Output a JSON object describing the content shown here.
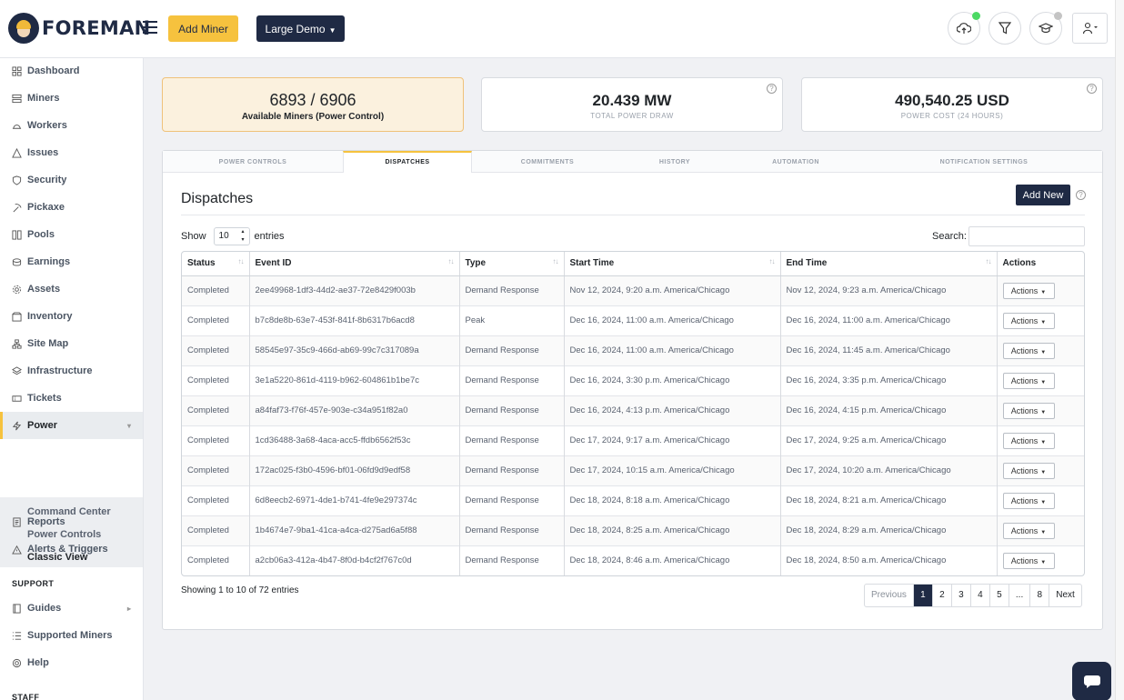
{
  "header": {
    "brand": "FOREMAN",
    "add_miner": "Add Miner",
    "demo": "Large Demo",
    "status_dot_colors": {
      "upload": "#4cd964",
      "learn": "#c4c4c4"
    }
  },
  "sidebar": {
    "items": [
      {
        "label": "Dashboard",
        "icon": "dashboard-icon"
      },
      {
        "label": "Miners",
        "icon": "server-icon"
      },
      {
        "label": "Workers",
        "icon": "hardhat-icon"
      },
      {
        "label": "Issues",
        "icon": "warning-icon"
      },
      {
        "label": "Security",
        "icon": "shield-icon"
      },
      {
        "label": "Pickaxe",
        "icon": "pickaxe-icon"
      },
      {
        "label": "Pools",
        "icon": "pools-icon"
      },
      {
        "label": "Earnings",
        "icon": "coins-icon"
      },
      {
        "label": "Assets",
        "icon": "gear-icon"
      },
      {
        "label": "Inventory",
        "icon": "box-icon"
      },
      {
        "label": "Site Map",
        "icon": "sitemap-icon"
      },
      {
        "label": "Infrastructure",
        "icon": "layers-icon"
      },
      {
        "label": "Tickets",
        "icon": "ticket-icon"
      },
      {
        "label": "Power",
        "icon": "bolt-icon"
      }
    ],
    "power_sub": [
      "Command Center",
      "Power Controls",
      "Classic View"
    ],
    "after_items": [
      {
        "label": "Reports",
        "icon": "report-icon"
      },
      {
        "label": "Alerts & Triggers",
        "icon": "alert-icon"
      }
    ],
    "support_label": "SUPPORT",
    "support_items": [
      {
        "label": "Guides",
        "icon": "book-icon"
      },
      {
        "label": "Supported Miners",
        "icon": "list-icon"
      },
      {
        "label": "Help",
        "icon": "lifebuoy-icon"
      }
    ],
    "staff_label": "STAFF"
  },
  "stats": [
    {
      "value": "6893 / 6906",
      "label": "Available Miners (Power Control)"
    },
    {
      "value": "20.439 MW",
      "label": "TOTAL POWER DRAW"
    },
    {
      "value": "490,540.25 USD",
      "label": "POWER COST (24 HOURS)"
    }
  ],
  "tabs": [
    "POWER CONTROLS",
    "DISPATCHES",
    "COMMITMENTS",
    "HISTORY",
    "AUTOMATION",
    "NOTIFICATION SETTINGS"
  ],
  "panel": {
    "title": "Dispatches",
    "add_new": "Add New",
    "show": "Show",
    "entries_value": "10",
    "entries": "entries",
    "search": "Search:",
    "showing": "Showing 1 to 10 of 72 entries",
    "action_label": "Actions"
  },
  "table": {
    "columns": [
      "Status",
      "Event ID",
      "Type",
      "Start Time",
      "End Time",
      "Actions"
    ],
    "rows": [
      [
        "Completed",
        "2ee49968-1df3-44d2-ae37-72e8429f003b",
        "Demand Response",
        "Nov 12, 2024, 9:20 a.m. America/Chicago",
        "Nov 12, 2024, 9:23 a.m. America/Chicago"
      ],
      [
        "Completed",
        "b7c8de8b-63e7-453f-841f-8b6317b6acd8",
        "Peak",
        "Dec 16, 2024, 11:00 a.m. America/Chicago",
        "Dec 16, 2024, 11:00 a.m. America/Chicago"
      ],
      [
        "Completed",
        "58545e97-35c9-466d-ab69-99c7c317089a",
        "Demand Response",
        "Dec 16, 2024, 11:00 a.m. America/Chicago",
        "Dec 16, 2024, 11:45 a.m. America/Chicago"
      ],
      [
        "Completed",
        "3e1a5220-861d-4119-b962-604861b1be7c",
        "Demand Response",
        "Dec 16, 2024, 3:30 p.m. America/Chicago",
        "Dec 16, 2024, 3:35 p.m. America/Chicago"
      ],
      [
        "Completed",
        "a84faf73-f76f-457e-903e-c34a951f82a0",
        "Demand Response",
        "Dec 16, 2024, 4:13 p.m. America/Chicago",
        "Dec 16, 2024, 4:15 p.m. America/Chicago"
      ],
      [
        "Completed",
        "1cd36488-3a68-4aca-acc5-ffdb6562f53c",
        "Demand Response",
        "Dec 17, 2024, 9:17 a.m. America/Chicago",
        "Dec 17, 2024, 9:25 a.m. America/Chicago"
      ],
      [
        "Completed",
        "172ac025-f3b0-4596-bf01-06fd9d9edf58",
        "Demand Response",
        "Dec 17, 2024, 10:15 a.m. America/Chicago",
        "Dec 17, 2024, 10:20 a.m. America/Chicago"
      ],
      [
        "Completed",
        "6d8eecb2-6971-4de1-b741-4fe9e297374c",
        "Demand Response",
        "Dec 18, 2024, 8:18 a.m. America/Chicago",
        "Dec 18, 2024, 8:21 a.m. America/Chicago"
      ],
      [
        "Completed",
        "1b4674e7-9ba1-41ca-a4ca-d275ad6a5f88",
        "Demand Response",
        "Dec 18, 2024, 8:25 a.m. America/Chicago",
        "Dec 18, 2024, 8:29 a.m. America/Chicago"
      ],
      [
        "Completed",
        "a2cb06a3-412a-4b47-8f0d-b4cf2f767c0d",
        "Demand Response",
        "Dec 18, 2024, 8:46 a.m. America/Chicago",
        "Dec 18, 2024, 8:50 a.m. America/Chicago"
      ]
    ]
  },
  "pagination": [
    "Previous",
    "1",
    "2",
    "3",
    "4",
    "5",
    "...",
    "8",
    "Next"
  ],
  "colors": {
    "accent": "#f6c23e",
    "navy": "#1f2a44"
  }
}
